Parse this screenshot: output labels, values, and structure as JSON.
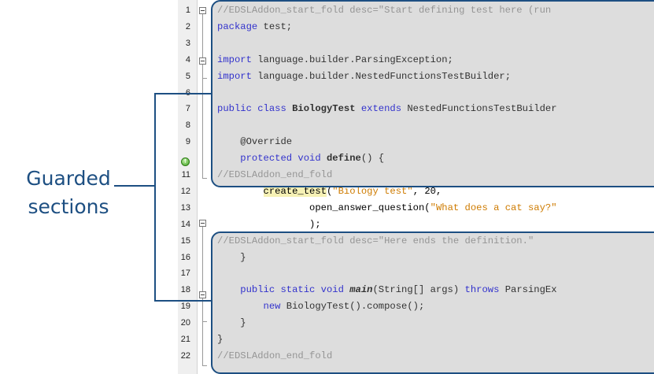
{
  "label": {
    "line1": "Guarded",
    "line2": "sections"
  },
  "colors": {
    "accent": "#1d4f82",
    "keyword": "#0000e6",
    "comment": "#969696",
    "string": "#ce7b00"
  },
  "editor": {
    "lines": [
      {
        "num": "1",
        "parts": [
          {
            "t": "//EDSLAddon_start_fold desc=\"Start defining test here (run",
            "c": "cm"
          }
        ]
      },
      {
        "num": "2",
        "parts": [
          {
            "t": "package",
            "c": "kw"
          },
          {
            "t": " test;",
            "c": ""
          }
        ]
      },
      {
        "num": "3",
        "parts": []
      },
      {
        "num": "4",
        "parts": [
          {
            "t": "import",
            "c": "kw"
          },
          {
            "t": " language.builder.ParsingException;",
            "c": ""
          }
        ]
      },
      {
        "num": "5",
        "parts": [
          {
            "t": "import",
            "c": "kw"
          },
          {
            "t": " language.builder.NestedFunctionsTestBuilder;",
            "c": ""
          }
        ]
      },
      {
        "num": "6",
        "parts": []
      },
      {
        "num": "7",
        "parts": [
          {
            "t": "public class ",
            "c": "kw"
          },
          {
            "t": "BiologyTest",
            "c": "b"
          },
          {
            "t": " extends ",
            "c": "kw"
          },
          {
            "t": "NestedFunctionsTestBuilder",
            "c": ""
          }
        ]
      },
      {
        "num": "8",
        "parts": []
      },
      {
        "num": "9",
        "parts": [
          {
            "t": "    @Override",
            "c": ""
          }
        ]
      },
      {
        "num": "",
        "parts": [
          {
            "t": "    protected void ",
            "c": "kw"
          },
          {
            "t": "define",
            "c": "b"
          },
          {
            "t": "() {",
            "c": ""
          }
        ]
      },
      {
        "num": "11",
        "parts": [
          {
            "t": "//EDSLAddon_end_fold",
            "c": "cm"
          }
        ]
      },
      {
        "num": "12",
        "parts": [
          {
            "t": "        ",
            "c": ""
          },
          {
            "t": "create_test",
            "c": "hl-test"
          },
          {
            "t": "(",
            "c": ""
          },
          {
            "t": "\"Biology test\"",
            "c": "st"
          },
          {
            "t": ", 20,",
            "c": ""
          }
        ]
      },
      {
        "num": "13",
        "parts": [
          {
            "t": "                ",
            "c": ""
          },
          {
            "t": "open_answer_question(",
            "c": ""
          },
          {
            "t": "\"What does a cat say?\"",
            "c": "st"
          }
        ]
      },
      {
        "num": "14",
        "parts": [
          {
            "t": "                );",
            "c": ""
          }
        ]
      },
      {
        "num": "15",
        "parts": [
          {
            "t": "//EDSLAddon_start_fold desc=\"Here ends the definition.\"",
            "c": "cm"
          }
        ]
      },
      {
        "num": "16",
        "parts": [
          {
            "t": "    }",
            "c": ""
          }
        ]
      },
      {
        "num": "17",
        "parts": []
      },
      {
        "num": "18",
        "parts": [
          {
            "t": "    public static void ",
            "c": "kw"
          },
          {
            "t": "main",
            "c": "bi"
          },
          {
            "t": "(String[] args) ",
            "c": ""
          },
          {
            "t": "throws",
            "c": "kw"
          },
          {
            "t": " ParsingEx",
            "c": ""
          }
        ]
      },
      {
        "num": "19",
        "parts": [
          {
            "t": "        new ",
            "c": "kw"
          },
          {
            "t": "BiologyTest().compose();",
            "c": ""
          }
        ]
      },
      {
        "num": "20",
        "parts": [
          {
            "t": "    }",
            "c": ""
          }
        ]
      },
      {
        "num": "21",
        "parts": [
          {
            "t": "}",
            "c": ""
          }
        ]
      },
      {
        "num": "22",
        "parts": [
          {
            "t": "//EDSLAddon_end_fold",
            "c": "cm"
          }
        ]
      }
    ],
    "override_icon_glyph": "↑"
  }
}
